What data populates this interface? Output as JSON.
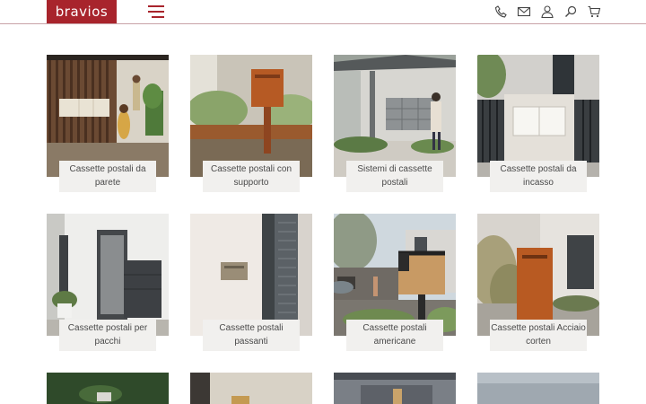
{
  "header": {
    "logo_text": "bravios",
    "brand_color": "#a8242c",
    "icons": [
      "phone-icon",
      "mail-icon",
      "user-icon",
      "search-icon",
      "cart-icon"
    ]
  },
  "products": [
    {
      "label": "Cassette postali da parete"
    },
    {
      "label": "Cassette postali con supporto"
    },
    {
      "label": "Sistemi di cassette postali"
    },
    {
      "label": "Cassette postali da incasso"
    },
    {
      "label": "Cassette postali per pacchi"
    },
    {
      "label": "Cassette postali passanti"
    },
    {
      "label": "Cassette postali americane"
    },
    {
      "label": "Cassette postali Acciaio corten"
    }
  ]
}
